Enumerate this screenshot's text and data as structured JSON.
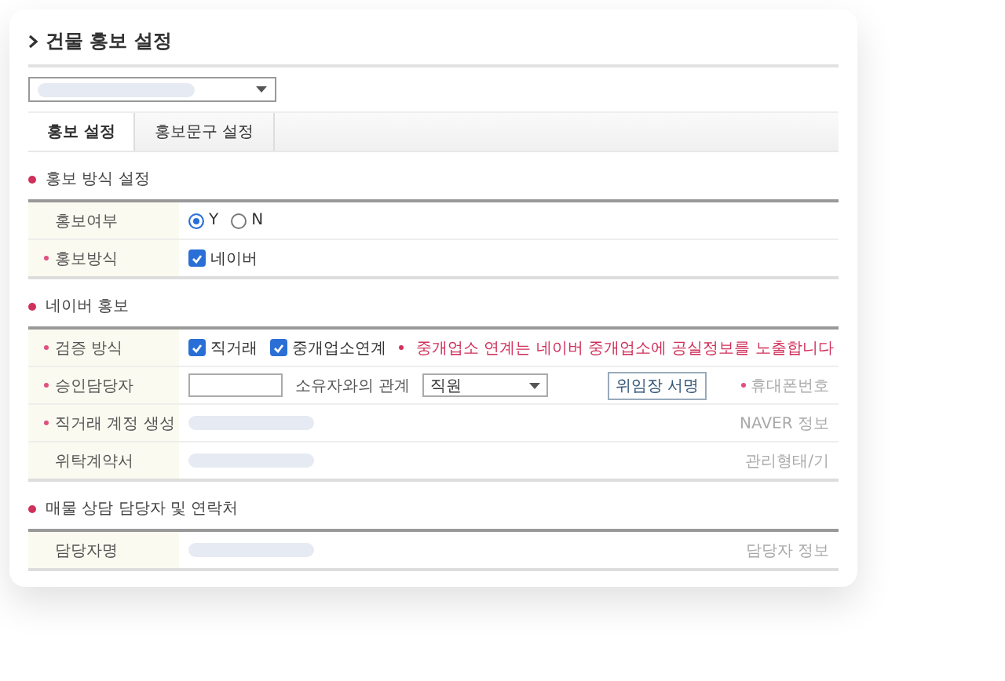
{
  "title": "건물 홍보 설정",
  "tabs": [
    {
      "label": "홍보 설정",
      "selected": true
    },
    {
      "label": "홍보문구 설정",
      "selected": false
    }
  ],
  "sections": [
    {
      "title": "홍보 방식 설정",
      "rows": [
        {
          "kind": "radio",
          "label": "홍보여부",
          "required": false,
          "options": [
            {
              "label": "Y",
              "selected": true
            },
            {
              "label": "N",
              "selected": false
            }
          ]
        },
        {
          "kind": "checkbox",
          "label": "홍보방식",
          "required": true,
          "options": [
            {
              "label": "네이버",
              "checked": true
            }
          ]
        }
      ]
    },
    {
      "title": "네이버 홍보",
      "rows": [
        {
          "kind": "checkbox",
          "label": "검증 방식",
          "required": true,
          "options": [
            {
              "label": "직거래",
              "checked": true
            },
            {
              "label": "중개업소연계",
              "checked": true
            }
          ],
          "notice": "중개업소 연계는 네이버 중개업소에 공실정보를 노출합니다"
        },
        {
          "kind": "approver",
          "label": "승인담당자",
          "required": true,
          "relation_label": "소유자와의 관계",
          "relation_value": "직원",
          "button": "위임장 서명",
          "side_label": {
            "text": "휴대폰번호",
            "required": true
          }
        },
        {
          "kind": "bar",
          "label": "직거래 계정 생성",
          "required": true,
          "side_label": {
            "text": "NAVER 정보",
            "required": false
          }
        },
        {
          "kind": "bar",
          "label": "위탁계약서",
          "required": false,
          "side_label": {
            "text": "관리형태/기",
            "required": false
          }
        }
      ]
    },
    {
      "title": "매물 상담 담당자 및 연락처",
      "rows": [
        {
          "kind": "bar",
          "label": "담당자명",
          "required": false,
          "side_label": {
            "text": "담당자 정보",
            "required": false
          }
        }
      ]
    }
  ]
}
